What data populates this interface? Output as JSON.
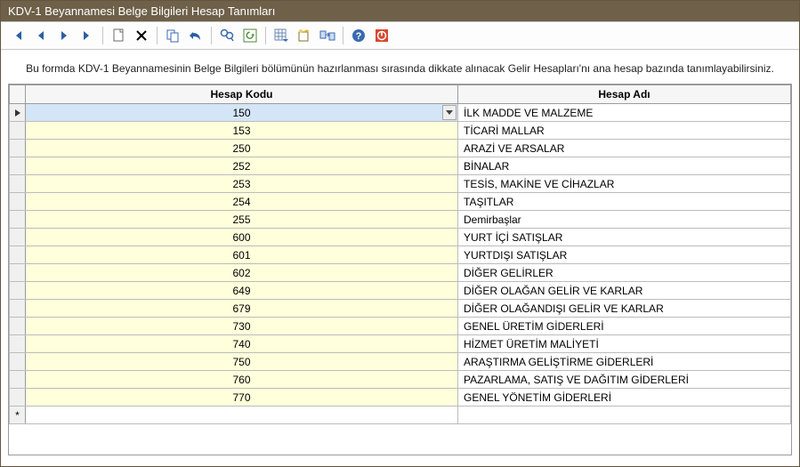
{
  "window": {
    "title": "KDV-1 Beyannamesi Belge Bilgileri Hesap Tanımları"
  },
  "description": "Bu formda KDV-1 Beyannamesinin Belge Bilgileri bölümünün hazırlanması sırasında dikkate alınacak Gelir Hesapları'nı ana hesap bazında tanımlayabilirsiniz.",
  "columns": {
    "code": "Hesap Kodu",
    "name": "Hesap Adı"
  },
  "rows": [
    {
      "code": "150",
      "name": "İLK MADDE VE MALZEME",
      "selected": true
    },
    {
      "code": "153",
      "name": "TİCARİ MALLAR"
    },
    {
      "code": "250",
      "name": "ARAZİ VE ARSALAR"
    },
    {
      "code": "252",
      "name": "BİNALAR"
    },
    {
      "code": "253",
      "name": "TESİS, MAKİNE VE CİHAZLAR"
    },
    {
      "code": "254",
      "name": "TAŞITLAR"
    },
    {
      "code": "255",
      "name": "Demirbaşlar"
    },
    {
      "code": "600",
      "name": "YURT İÇİ SATIŞLAR"
    },
    {
      "code": "601",
      "name": "YURTDIŞI SATIŞLAR"
    },
    {
      "code": "602",
      "name": "DİĞER GELİRLER"
    },
    {
      "code": "649",
      "name": "DİĞER OLAĞAN GELİR VE KARLAR"
    },
    {
      "code": "679",
      "name": "DİĞER OLAĞANDIŞI GELİR VE KARLAR"
    },
    {
      "code": "730",
      "name": "GENEL ÜRETİM GİDERLERİ"
    },
    {
      "code": "740",
      "name": "HİZMET ÜRETİM MALİYETİ"
    },
    {
      "code": "750",
      "name": "ARAŞTIRMA GELİŞTİRME GİDERLERİ"
    },
    {
      "code": "760",
      "name": "PAZARLAMA, SATIŞ VE DAĞITIM GİDERLERİ"
    },
    {
      "code": "770",
      "name": "GENEL YÖNETİM GİDERLERİ"
    }
  ],
  "newrow_marker": "*"
}
